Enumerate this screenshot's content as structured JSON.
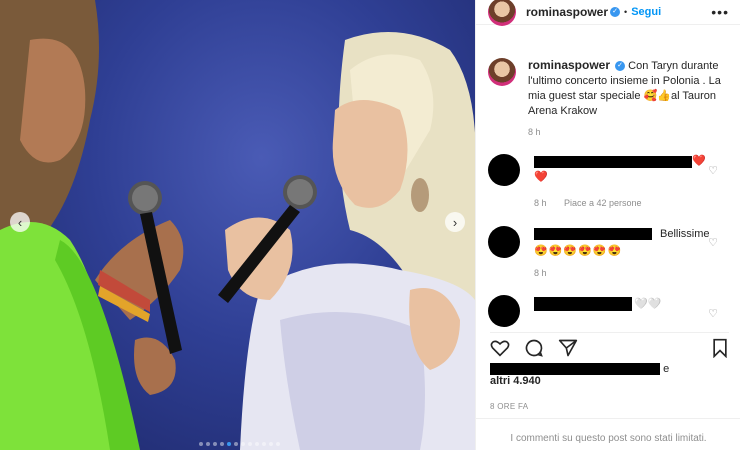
{
  "post": {
    "username": "rominaspower",
    "follow_label": "Segui",
    "more_label": "•••",
    "caption": "Con Taryn durante l'ultimo concerto insieme in Polonia . La mia guest star speciale 🥰👍al Tauron Arena Krakow",
    "caption_time": "8 h"
  },
  "comments": [
    {
      "emoji_line": "❤️",
      "time": "8 h",
      "reply": "Piace a 42 persone",
      "trail": "❤️"
    },
    {
      "text": "Bellissime",
      "emoji_line": "😍😍😍😍😍😍",
      "time": "8 h"
    },
    {
      "trail": "🤍🤍"
    }
  ],
  "likes": {
    "suffix": "e",
    "others": "altri 4.940"
  },
  "post_date": "8 ORE FA",
  "comments_limited": "I commenti su questo post sono stati limitati.",
  "icons": {
    "heart": "heart-icon",
    "comment": "comment-icon",
    "share": "share-icon",
    "bookmark": "bookmark-icon",
    "prev": "chevron-left-icon",
    "next": "chevron-right-icon"
  },
  "colors": {
    "link": "#0095f6",
    "verified": "#3897f0",
    "heart": "#ed4956",
    "carousel_active": "#3897f0"
  },
  "carousel": {
    "total": 12,
    "active": 4
  }
}
